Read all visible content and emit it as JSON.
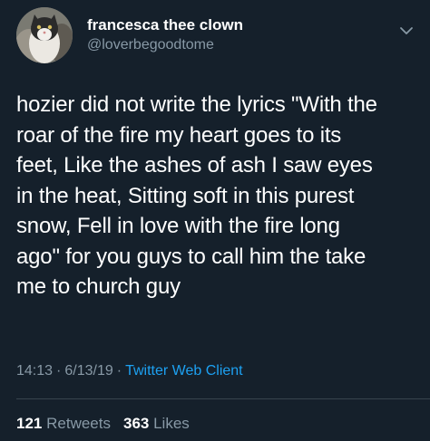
{
  "user": {
    "display_name": "francesca thee clown",
    "handle": "@loverbegoodtome",
    "avatar_icon": "cat-avatar-icon"
  },
  "tweet": {
    "lines": [
      "hozier did not write the lyrics \"With the",
      "roar of the fire my heart goes to its",
      "feet, Like the ashes of ash I saw eyes",
      "in the heat, Sitting soft in this purest",
      "snow, Fell in love with the fire long",
      "ago\" for you guys to call him the take",
      "me to church guy"
    ]
  },
  "meta": {
    "time": "14:13",
    "separator": "·",
    "date": "6/13/19",
    "client": "Twitter Web Client"
  },
  "stats": {
    "retweets_count": "121",
    "retweets_label": "Retweets",
    "likes_count": "363",
    "likes_label": "Likes"
  },
  "colors": {
    "background": "#15202b",
    "secondary_text": "#8899a6",
    "link": "#1da1f2",
    "divider": "#38444d"
  }
}
